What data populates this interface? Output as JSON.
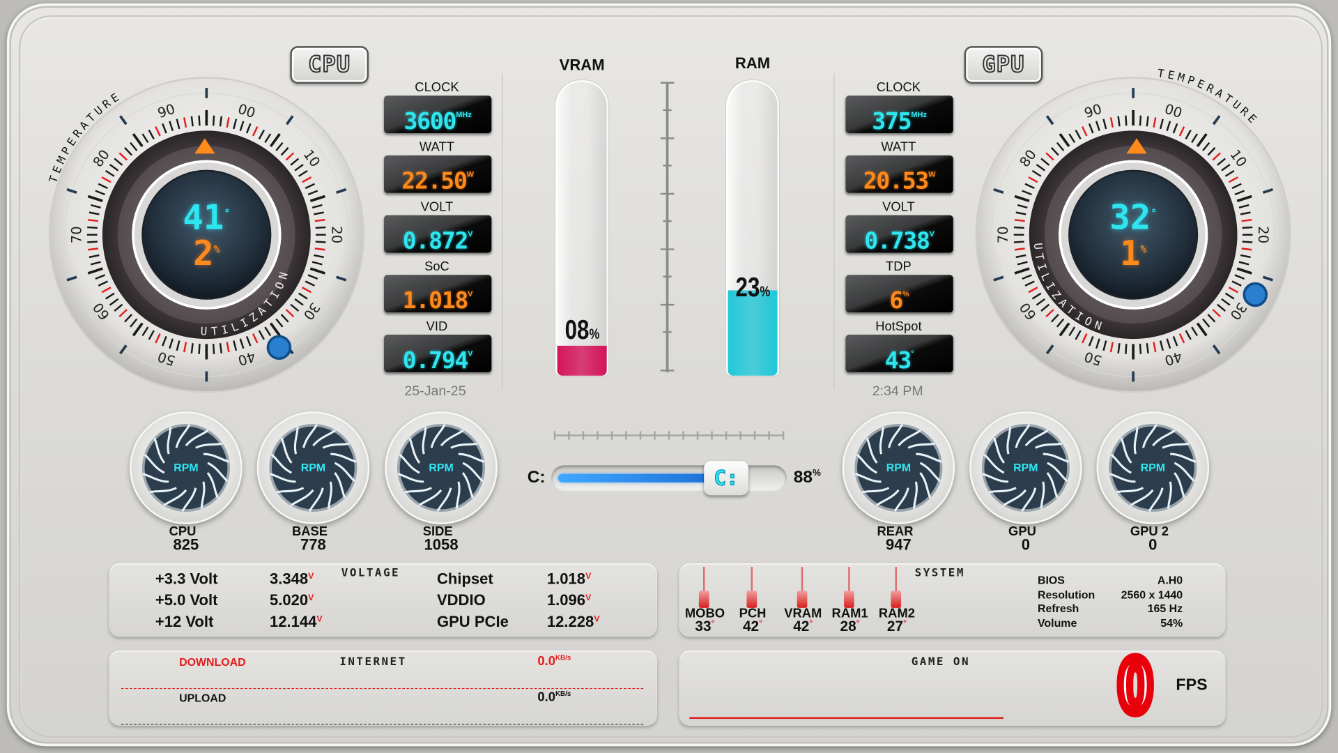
{
  "cpu": {
    "badge": "CPU",
    "temp_label": "TEMPERATURE",
    "util_label": "UTILIZATION",
    "temp": "41",
    "temp_unit": "°",
    "util": "2",
    "util_unit": "%",
    "ticks": [
      "00",
      "10",
      "20",
      "30",
      "40",
      "50",
      "60",
      "70",
      "80",
      "90"
    ],
    "stats": [
      {
        "label": "CLOCK",
        "value": "3600",
        "unit": "MHz",
        "color": "cyan"
      },
      {
        "label": "WATT",
        "value": "22.50",
        "unit": "W",
        "color": "orange"
      },
      {
        "label": "VOLT",
        "value": "0.872",
        "unit": "V",
        "color": "cyan"
      },
      {
        "label": "SoC",
        "value": "1.018",
        "unit": "V",
        "color": "orange"
      },
      {
        "label": "VID",
        "value": "0.794",
        "unit": "V",
        "color": "cyan"
      }
    ],
    "date": "25-Jan-25"
  },
  "gpu": {
    "badge": "GPU",
    "temp_label": "TEMPERATURE",
    "util_label": "UTILIZATION",
    "temp": "32",
    "temp_unit": "°",
    "util": "1",
    "util_unit": "%",
    "ticks": [
      "00",
      "10",
      "20",
      "30",
      "40",
      "50",
      "60",
      "70",
      "80",
      "90"
    ],
    "stats": [
      {
        "label": "CLOCK",
        "value": "375",
        "unit": "MHz",
        "color": "cyan"
      },
      {
        "label": "WATT",
        "value": "20.53",
        "unit": "W",
        "color": "orange"
      },
      {
        "label": "VOLT",
        "value": "0.738",
        "unit": "V",
        "color": "cyan"
      },
      {
        "label": "TDP",
        "value": "6",
        "unit": "%",
        "color": "orange"
      },
      {
        "label": "HotSpot",
        "value": "43",
        "unit": "°",
        "color": "cyan"
      }
    ],
    "time": "2:34 PM"
  },
  "memory": {
    "vram": {
      "label": "VRAM",
      "value": "08",
      "unit": "%",
      "level": 0.08,
      "color": "#d4145a"
    },
    "ram": {
      "label": "RAM",
      "value": "23",
      "unit": "%",
      "level": 0.23,
      "color": "#22c7d8"
    }
  },
  "drive": {
    "label": "C:",
    "knob": "C:",
    "value": "88",
    "unit": "%",
    "level": 0.88
  },
  "fans": [
    {
      "name": "CPU",
      "value": "825"
    },
    {
      "name": "BASE",
      "value": "778"
    },
    {
      "name": "SIDE",
      "value": "1058"
    },
    {
      "name": "REAR",
      "value": "947"
    },
    {
      "name": "GPU",
      "value": "0"
    },
    {
      "name": "GPU 2",
      "value": "0"
    }
  ],
  "fan_label": "RPM",
  "voltage": {
    "title": "VOLTAGE",
    "rows_left": [
      {
        "name": "+3.3 Volt",
        "value": "3.348"
      },
      {
        "name": "+5.0 Volt",
        "value": "5.020"
      },
      {
        "name": "+12  Volt",
        "value": "12.144"
      }
    ],
    "rows_right": [
      {
        "name": "Chipset",
        "value": "1.018"
      },
      {
        "name": "VDDIO",
        "value": "1.096"
      },
      {
        "name": "GPU PCIe",
        "value": "12.228"
      }
    ],
    "unit": "V"
  },
  "system": {
    "title": "SYSTEM",
    "temps": [
      {
        "name": "MOBO",
        "value": "33"
      },
      {
        "name": "PCH",
        "value": "42"
      },
      {
        "name": "VRAM",
        "value": "42"
      },
      {
        "name": "RAM1",
        "value": "28"
      },
      {
        "name": "RAM2",
        "value": "27"
      }
    ],
    "temp_unit": "°",
    "info": [
      {
        "k": "BIOS",
        "v": "A.H0"
      },
      {
        "k": "Resolution",
        "v": "2560 x 1440"
      },
      {
        "k": "Refresh",
        "v": "165 Hz"
      },
      {
        "k": "Volume",
        "v": "54%"
      }
    ]
  },
  "internet": {
    "title": "INTERNET",
    "download_label": "DOWNLOAD",
    "download": "0.0",
    "upload_label": "UPLOAD",
    "upload": "0.0",
    "unit": "KB/s"
  },
  "game": {
    "title": "GAME ON",
    "fps": "0",
    "fps_label": "FPS"
  },
  "colors": {
    "cyan": "#2ee6f0",
    "orange": "#ff8a1c",
    "red": "#e21d1d",
    "gauge_dark": "#2a3a48"
  }
}
